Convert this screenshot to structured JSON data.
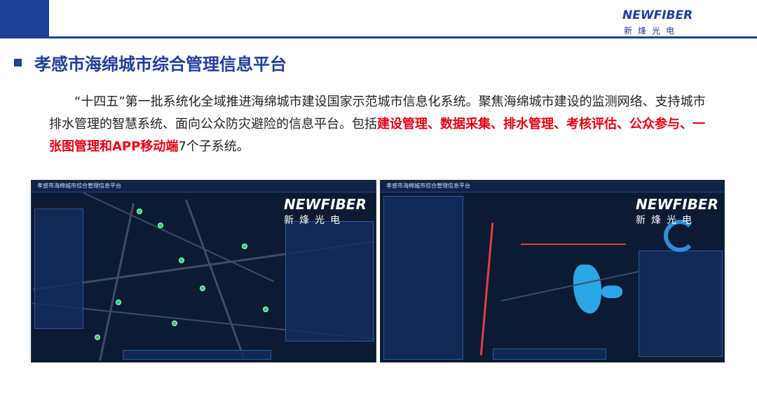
{
  "brand": {
    "logo_en": "NEWFIBER",
    "logo_cn": "新烽光电"
  },
  "heading": {
    "title": "孝感市海绵城市综合管理信息平台"
  },
  "body": {
    "text_part1": "“十四五”第一批系统化全域推进海绵城市建设国家示范城市信息化系统。聚焦海绵城市建设的监测网络、支持城市排水管理的智慧系统、面向公众防灾避险的信息平台。包括",
    "text_highlight": "建设管理、数据采集、排水管理、考核评估、公众参与、一张图管理和APP移动端",
    "text_part2": "7个子系统。"
  },
  "screenshots": {
    "left": {
      "app_title": "孝感市海绵城市综合管理信息平台"
    },
    "right": {
      "app_title": "孝感市海绵城市综合管理信息平台"
    },
    "watermark_en": "NEWFIBER",
    "watermark_cn": "新烽光电"
  },
  "colors": {
    "brand_blue": "#1f3f99",
    "highlight_red": "#e60012"
  }
}
